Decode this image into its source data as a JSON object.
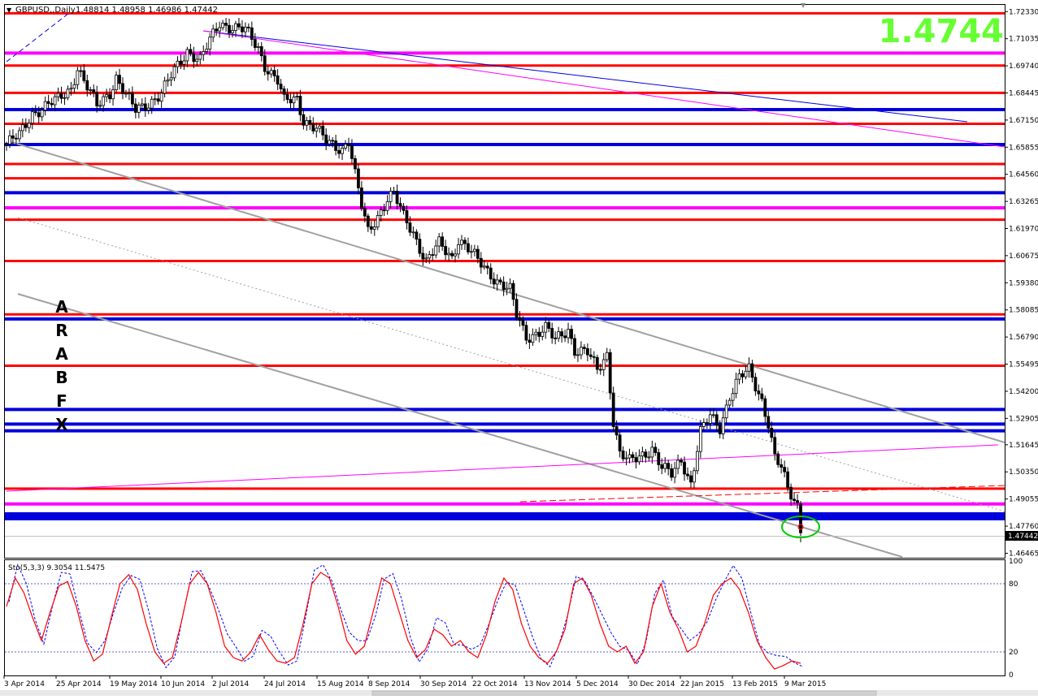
{
  "header": {
    "symbol": "GBPUSD,,Daily",
    "ohlc": "1.48814 1.48958 1.46986 1.47442"
  },
  "big_price": "1.4744",
  "watermark_letters": [
    "A",
    "R",
    "A",
    "B",
    "F",
    "X"
  ],
  "current_price_label": "1.47442",
  "colors": {
    "background": "#ffffff",
    "red_line": "#ff0000",
    "blue_line": "#0000dd",
    "magenta_line": "#ff00ff",
    "channel_gray": "#a0a0a0",
    "big_price_green": "#66ff33",
    "candle": "#000000",
    "sto_main": "#ff0000",
    "sto_signal": "#0000ff",
    "highlight_circle": "#00cc00"
  },
  "chart_data": [
    {
      "type": "candlestick",
      "title": "GBPUSD,,Daily",
      "y_ticks": [
        "1.72330",
        "1.71035",
        "1.69740",
        "1.68445",
        "1.67150",
        "1.65855",
        "1.64560",
        "1.63265",
        "1.61970",
        "1.60675",
        "1.59380",
        "1.58085",
        "1.56790",
        "1.55495",
        "1.54200",
        "1.52905",
        "1.51645",
        "1.50350",
        "1.49055",
        "1.47760",
        "1.46465"
      ],
      "ylim": [
        1.4625,
        1.7265
      ],
      "x_ticks": [
        "3 Apr 2014",
        "25 Apr 2014",
        "19 May 2014",
        "10 Jun 2014",
        "2 Jul 2014",
        "24 Jul 2014",
        "15 Aug 2014",
        "8 Sep 2014",
        "30 Sep 2014",
        "22 Oct 2014",
        "13 Nov 2014",
        "5 Dec 2014",
        "30 Dec 2014",
        "22 Jan 2015",
        "13 Feb 2015",
        "9 Mar 2015"
      ],
      "close_path": [
        [
          0,
          1.66
        ],
        [
          4,
          1.664
        ],
        [
          8,
          1.675
        ],
        [
          12,
          1.678
        ],
        [
          16,
          1.681
        ],
        [
          20,
          1.687
        ],
        [
          22,
          1.697
        ],
        [
          24,
          1.69
        ],
        [
          28,
          1.678
        ],
        [
          32,
          1.685
        ],
        [
          34,
          1.692
        ],
        [
          37,
          1.683
        ],
        [
          40,
          1.676
        ],
        [
          44,
          1.68
        ],
        [
          48,
          1.684
        ],
        [
          52,
          1.695
        ],
        [
          56,
          1.705
        ],
        [
          60,
          1.7
        ],
        [
          64,
          1.712
        ],
        [
          66,
          1.718
        ],
        [
          70,
          1.716
        ],
        [
          74,
          1.714
        ],
        [
          78,
          1.706
        ],
        [
          80,
          1.698
        ],
        [
          84,
          1.69
        ],
        [
          86,
          1.68
        ],
        [
          90,
          1.682
        ],
        [
          92,
          1.672
        ],
        [
          96,
          1.667
        ],
        [
          99,
          1.661
        ],
        [
          104,
          1.658
        ],
        [
          106,
          1.662
        ],
        [
          108,
          1.645
        ],
        [
          110,
          1.63
        ],
        [
          112,
          1.618
        ],
        [
          115,
          1.626
        ],
        [
          118,
          1.634
        ],
        [
          120,
          1.636
        ],
        [
          123,
          1.625
        ],
        [
          126,
          1.618
        ],
        [
          130,
          1.604
        ],
        [
          134,
          1.612
        ],
        [
          138,
          1.606
        ],
        [
          140,
          1.615
        ],
        [
          143,
          1.61
        ],
        [
          146,
          1.604
        ],
        [
          150,
          1.598
        ],
        [
          152,
          1.595
        ],
        [
          156,
          1.59
        ],
        [
          158,
          1.578
        ],
        [
          161,
          1.568
        ],
        [
          164,
          1.57
        ],
        [
          167,
          1.572
        ],
        [
          170,
          1.566
        ],
        [
          174,
          1.572
        ],
        [
          176,
          1.562
        ],
        [
          180,
          1.56
        ],
        [
          183,
          1.552
        ],
        [
          186,
          1.56
        ],
        [
          188,
          1.528
        ],
        [
          190,
          1.512
        ],
        [
          193,
          1.508
        ],
        [
          197,
          1.512
        ],
        [
          200,
          1.515
        ],
        [
          203,
          1.505
        ],
        [
          206,
          1.502
        ],
        [
          209,
          1.51
        ],
        [
          212,
          1.498
        ],
        [
          215,
          1.522
        ],
        [
          218,
          1.53
        ],
        [
          221,
          1.525
        ],
        [
          224,
          1.54
        ],
        [
          227,
          1.548
        ],
        [
          230,
          1.552
        ],
        [
          232,
          1.545
        ],
        [
          234,
          1.538
        ],
        [
          236,
          1.527
        ],
        [
          238,
          1.51
        ],
        [
          240,
          1.505
        ],
        [
          242,
          1.495
        ],
        [
          245,
          1.488
        ],
        [
          246,
          1.4744
        ]
      ],
      "horizontal_levels": [
        {
          "price": 1.7225,
          "color": "red"
        },
        {
          "price": 1.7035,
          "color": "magenta"
        },
        {
          "price": 1.6975,
          "color": "red"
        },
        {
          "price": 1.6845,
          "color": "red"
        },
        {
          "price": 1.6765,
          "color": "blue"
        },
        {
          "price": 1.6697,
          "color": "red"
        },
        {
          "price": 1.6598,
          "color": "blue"
        },
        {
          "price": 1.6505,
          "color": "red"
        },
        {
          "price": 1.6437,
          "color": "red"
        },
        {
          "price": 1.6368,
          "color": "blue"
        },
        {
          "price": 1.6296,
          "color": "magenta"
        },
        {
          "price": 1.6239,
          "color": "red"
        },
        {
          "price": 1.6042,
          "color": "red"
        },
        {
          "price": 1.5787,
          "color": "red"
        },
        {
          "price": 1.5765,
          "color": "blue"
        },
        {
          "price": 1.5542,
          "color": "red"
        },
        {
          "price": 1.5333,
          "color": "blue"
        },
        {
          "price": 1.5263,
          "color": "blue"
        },
        {
          "price": 1.5231,
          "color": "blue"
        },
        {
          "price": 1.4955,
          "color": "red"
        },
        {
          "price": 1.4882,
          "color": "magenta"
        },
        {
          "price": 1.4823,
          "color": "blue"
        }
      ]
    },
    {
      "type": "line",
      "title": "Sto(5,3,3) 9.3054 11.5475",
      "y_ticks": [
        "100",
        "80",
        "20",
        "0"
      ],
      "ylim": [
        0,
        100
      ],
      "series": [
        {
          "color": "red",
          "values": [
            60,
            85,
            72,
            50,
            30,
            55,
            78,
            82,
            60,
            30,
            12,
            18,
            50,
            80,
            88,
            75,
            45,
            20,
            10,
            15,
            45,
            80,
            90,
            80,
            55,
            25,
            15,
            12,
            20,
            35,
            22,
            12,
            10,
            15,
            45,
            80,
            90,
            85,
            60,
            30,
            18,
            25,
            55,
            85,
            80,
            55,
            30,
            15,
            22,
            40,
            35,
            25,
            30,
            20,
            15,
            35,
            65,
            85,
            75,
            45,
            25,
            15,
            10,
            20,
            40,
            80,
            85,
            70,
            45,
            25,
            20,
            25,
            10,
            20,
            60,
            80,
            55,
            40,
            20,
            25,
            45,
            70,
            80,
            85,
            75,
            55,
            30,
            15,
            5,
            8,
            12,
            10
          ]
        }
      ]
    }
  ]
}
